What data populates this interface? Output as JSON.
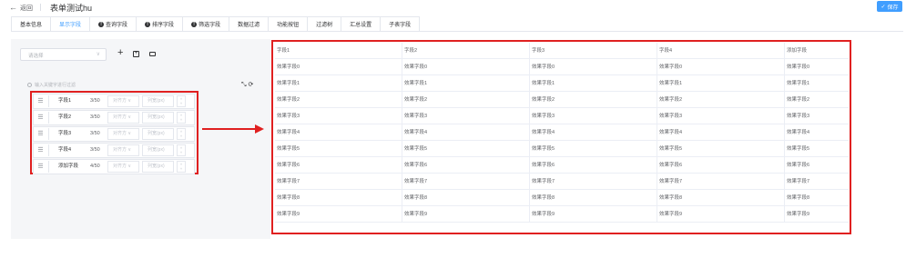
{
  "header": {
    "back": "返回",
    "title": "表单测试hu",
    "save": "保存"
  },
  "tabs": [
    {
      "label": "基本信息",
      "badge": false
    },
    {
      "label": "显示字段",
      "badge": false,
      "active": true
    },
    {
      "label": "查询字段",
      "badge": true
    },
    {
      "label": "排序字段",
      "badge": true
    },
    {
      "label": "筛选字段",
      "badge": true
    },
    {
      "label": "数据过滤",
      "badge": false
    },
    {
      "label": "功能按钮",
      "badge": false
    },
    {
      "label": "过滤树",
      "badge": false
    },
    {
      "label": "汇总设置",
      "badge": false
    },
    {
      "label": "子表字段",
      "badge": false
    }
  ],
  "left": {
    "select_placeholder": "请选择",
    "filter_placeholder": "输入关键字进行过滤",
    "fields": [
      {
        "name": "字段1",
        "count": "3/50",
        "align": "对齐方",
        "width": "列宽(px)"
      },
      {
        "name": "字段2",
        "count": "3/50",
        "align": "对齐方",
        "width": "列宽(px)"
      },
      {
        "name": "字段3",
        "count": "3/50",
        "align": "对齐方",
        "width": "列宽(px)"
      },
      {
        "name": "字段4",
        "count": "3/50",
        "align": "对齐方",
        "width": "列宽(px)"
      },
      {
        "name": "添加字段",
        "count": "4/50",
        "align": "对齐方",
        "width": "列宽(px)"
      }
    ]
  },
  "table": {
    "headers": [
      "字段1",
      "字段2",
      "字段3",
      "字段4",
      "添加字段"
    ],
    "rows": [
      [
        "效果字段0",
        "效果字段0",
        "效果字段0",
        "效果字段0",
        "效果字段0"
      ],
      [
        "效果字段1",
        "效果字段1",
        "效果字段1",
        "效果字段1",
        "效果字段1"
      ],
      [
        "效果字段2",
        "效果字段2",
        "效果字段2",
        "效果字段2",
        "效果字段2"
      ],
      [
        "效果字段3",
        "效果字段3",
        "效果字段3",
        "效果字段3",
        "效果字段3"
      ],
      [
        "效果字段4",
        "效果字段4",
        "效果字段4",
        "效果字段4",
        "效果字段4"
      ],
      [
        "效果字段5",
        "效果字段5",
        "效果字段5",
        "效果字段5",
        "效果字段5"
      ],
      [
        "效果字段6",
        "效果字段6",
        "效果字段6",
        "效果字段6",
        "效果字段6"
      ],
      [
        "效果字段7",
        "效果字段7",
        "效果字段7",
        "效果字段7",
        "效果字段7"
      ],
      [
        "效果字段8",
        "效果字段8",
        "效果字段8",
        "效果字段8",
        "效果字段8"
      ],
      [
        "效果字段9",
        "效果字段9",
        "效果字段9",
        "效果字段9",
        "效果字段9"
      ]
    ]
  },
  "colors": {
    "accent": "#409eff",
    "annotation": "#e02020"
  }
}
